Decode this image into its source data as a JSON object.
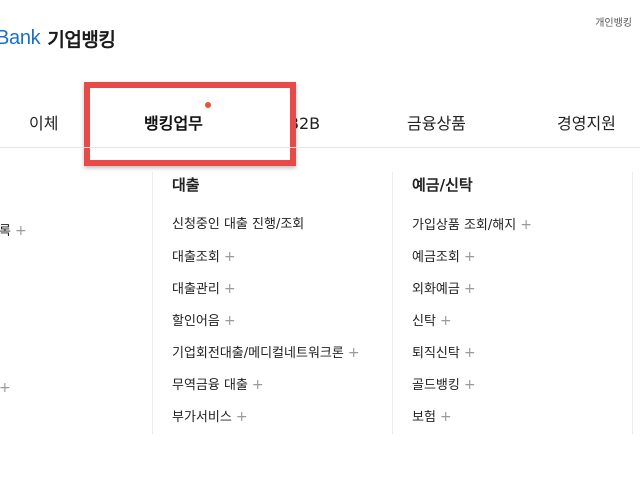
{
  "header": {
    "brand": "Bank",
    "service_name": "기업뱅킹",
    "util_link": "개인뱅킹"
  },
  "gnb": {
    "items": [
      {
        "label": "이체"
      },
      {
        "label": "뱅킹업무",
        "active": true,
        "has_new_dot": true
      },
      {
        "label": "B2B"
      },
      {
        "label": "금융상품"
      },
      {
        "label": "경영지원"
      }
    ]
  },
  "submenu": {
    "left_partial_items": [
      "록",
      ""
    ],
    "columns": [
      {
        "title": "대출",
        "items": [
          {
            "label": "신청중인 대출 진행/조회",
            "has_plus": false
          },
          {
            "label": "대출조회",
            "has_plus": true
          },
          {
            "label": "대출관리",
            "has_plus": true
          },
          {
            "label": "할인어음",
            "has_plus": true
          },
          {
            "label": "기업회전대출/메디컬네트워크론",
            "has_plus": true
          },
          {
            "label": "무역금융 대출",
            "has_plus": true
          },
          {
            "label": "부가서비스",
            "has_plus": true
          }
        ]
      },
      {
        "title": "예금/신탁",
        "items": [
          {
            "label": "가입상품 조회/해지",
            "has_plus": true
          },
          {
            "label": "예금조회",
            "has_plus": true
          },
          {
            "label": "외화예금",
            "has_plus": true
          },
          {
            "label": "신탁",
            "has_plus": true
          },
          {
            "label": "퇴직신탁",
            "has_plus": true
          },
          {
            "label": "골드뱅킹",
            "has_plus": true
          },
          {
            "label": "보험",
            "has_plus": true
          }
        ]
      }
    ]
  },
  "colors": {
    "brand": "#1a6fc9",
    "highlight": "#e84a4a",
    "new_dot": "#e8513a",
    "plus": "#9a9a9a"
  },
  "icons": {
    "plus": "+"
  }
}
